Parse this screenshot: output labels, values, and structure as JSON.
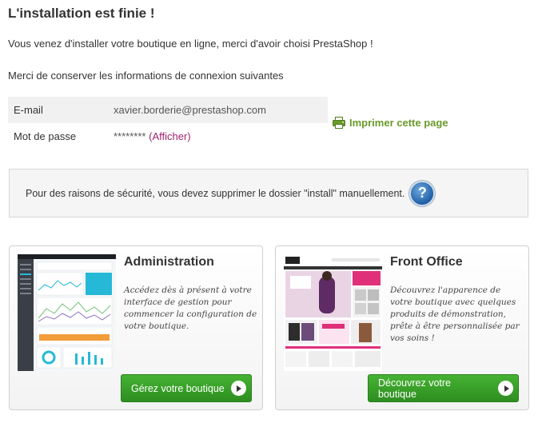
{
  "title": "L'installation est finie !",
  "intro": "Vous venez d'installer votre boutique en ligne, merci d'avoir choisi PrestaShop !",
  "keep_info": "Merci de conserver les informations de connexion suivantes",
  "credentials": {
    "email_label": "E-mail",
    "email_value": "xavier.borderie@prestashop.com",
    "password_label": "Mot de passe",
    "password_value": "********",
    "show_link": "(Afficher)"
  },
  "print_label": "Imprimer cette page",
  "security_warning": "Pour des raisons de sécurité, vous devez supprimer le dossier \"install\" manuellement.",
  "admin_card": {
    "title": "Administration",
    "description": "Accédez dès à présent à votre interface de gestion pour commencer la configuration de votre boutique.",
    "button": "Gérez votre boutique"
  },
  "front_card": {
    "title": "Front Office",
    "description": "Découvrez l'apparence de votre boutique avec quelques produits de démonstration, prête à être personnalisée par vos soins !",
    "button": "Découvrez votre boutique"
  },
  "colors": {
    "accent_green": "#6a9a2b",
    "button_green": "#3aa02a",
    "link_pink": "#a0246b",
    "help_blue": "#1f5fa5"
  },
  "icons": {
    "print": "printer-icon",
    "help": "question-icon",
    "button_arrow": "play-arrow-icon"
  }
}
